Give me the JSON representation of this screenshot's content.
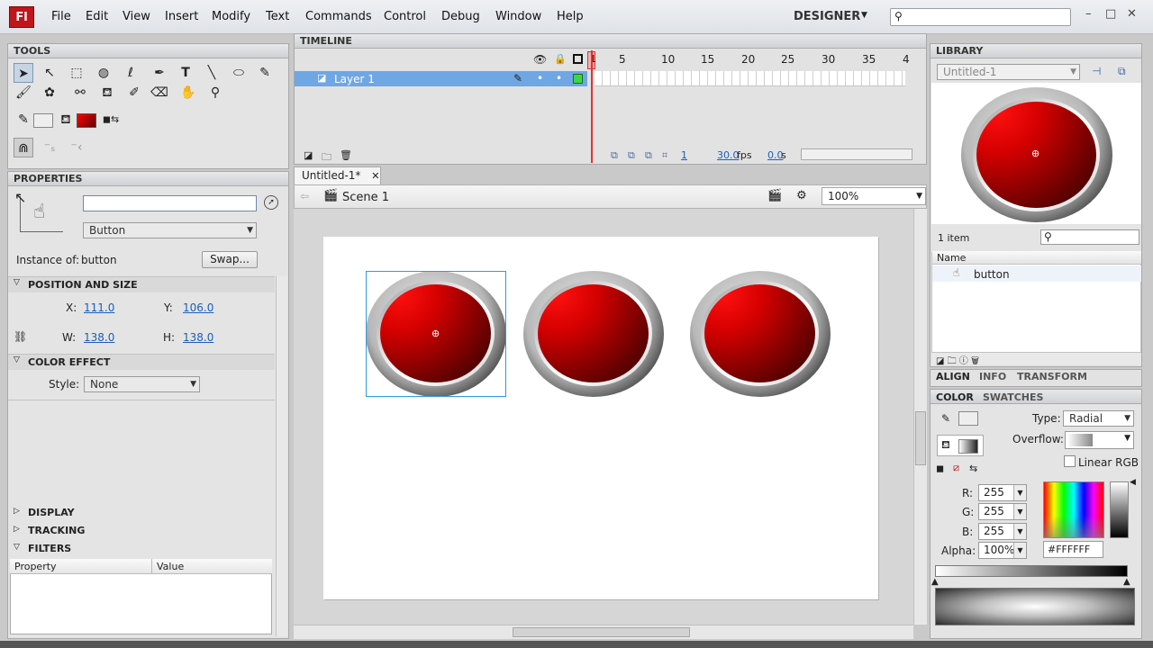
{
  "app": {
    "logo": "Fl",
    "workspace": "DESIGNER"
  },
  "menu": [
    "File",
    "Edit",
    "View",
    "Insert",
    "Modify",
    "Text",
    "Commands",
    "Control",
    "Debug",
    "Window",
    "Help"
  ],
  "window_controls": {
    "minimize": "–",
    "restore": "□",
    "close": "✕"
  },
  "tools": {
    "title": "TOOLS"
  },
  "properties": {
    "title": "PROPERTIES",
    "instance_name_value": "",
    "symbol_type": "Button",
    "instance_of_label": "Instance of:",
    "instance_of_value": "button",
    "swap_label": "Swap...",
    "position_size": {
      "title": "POSITION AND SIZE",
      "x_label": "X:",
      "x": "111.0",
      "y_label": "Y:",
      "y": "106.0",
      "w_label": "W:",
      "w": "138.0",
      "h_label": "H:",
      "h": "138.0"
    },
    "color_effect": {
      "title": "COLOR EFFECT",
      "style_label": "Style:",
      "style_value": "None"
    },
    "display_title": "DISPLAY",
    "tracking_title": "TRACKING",
    "filters_title": "FILTERS",
    "filters_columns": [
      "Property",
      "Value"
    ]
  },
  "timeline": {
    "title": "TIMELINE",
    "layer_name": "Layer 1",
    "frame_numbers": [
      "1",
      "5",
      "10",
      "15",
      "20",
      "25",
      "30",
      "35",
      "4"
    ],
    "current_frame": "1",
    "fps": "30.0",
    "fps_unit": "fps",
    "time": "0.0",
    "time_unit": "s"
  },
  "document": {
    "tab_title": "Untitled-1*",
    "scene": "Scene 1",
    "zoom": "100%"
  },
  "library": {
    "title": "LIBRARY",
    "document": "Untitled-1",
    "item_count": "1 item",
    "name_column": "Name",
    "items": [
      "button"
    ]
  },
  "align_tabs": [
    "ALIGN",
    "INFO",
    "TRANSFORM"
  ],
  "color_panel": {
    "tabs": [
      "COLOR",
      "SWATCHES"
    ],
    "type_label": "Type:",
    "type_value": "Radial",
    "overflow_label": "Overflow:",
    "linear_rgb_label": "Linear RGB",
    "r_label": "R:",
    "r": "255",
    "g_label": "G:",
    "g": "255",
    "b_label": "B:",
    "b": "255",
    "alpha_label": "Alpha:",
    "alpha": "100%",
    "hex": "#FFFFFF"
  },
  "colors": {
    "accent": "#6fa6e4",
    "playhead": "#e53030",
    "button_red": "#d40000"
  }
}
